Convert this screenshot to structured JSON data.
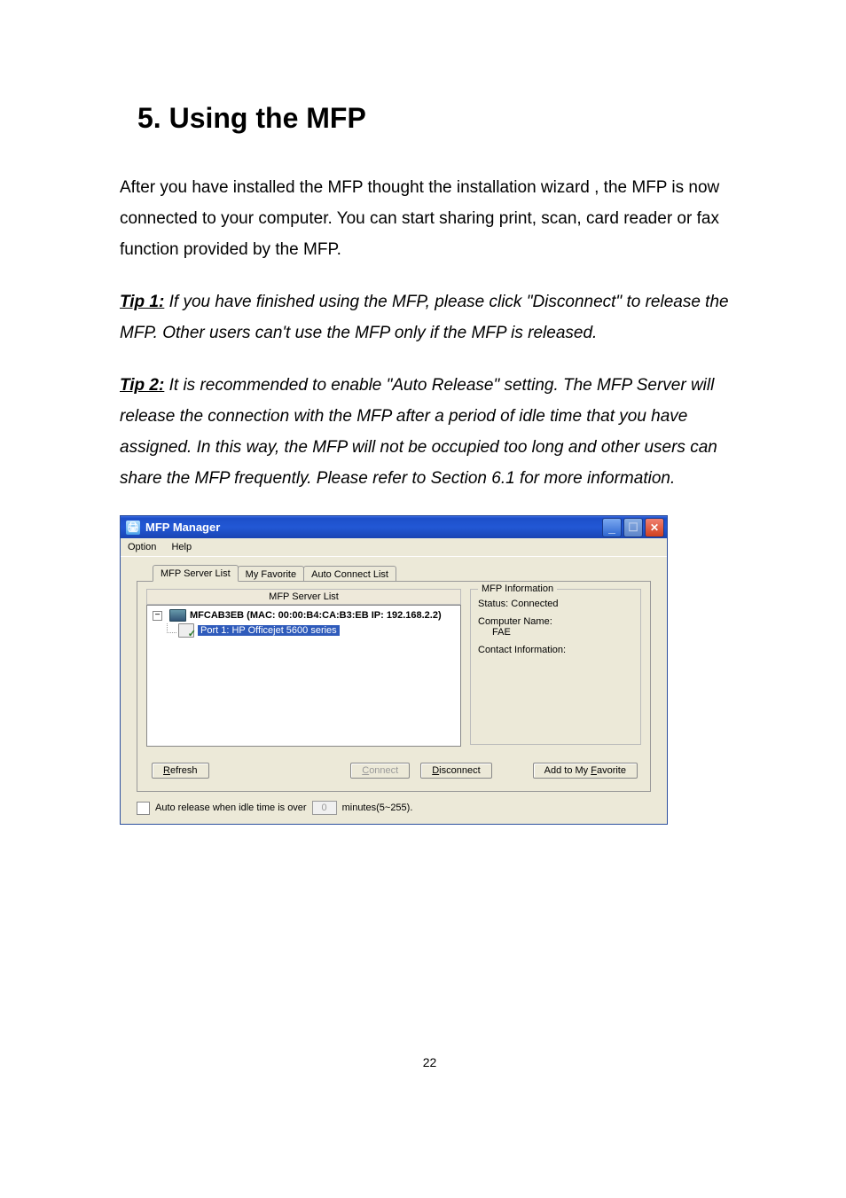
{
  "doc": {
    "heading": "5.  Using the MFP",
    "para1": "After you have installed the MFP thought the installation wizard , the MFP is now connected to your computer. You can start sharing print, scan, card reader or fax function provided by the MFP.",
    "tip1_label": "Tip 1:",
    "tip1_body": " If you have finished using the MFP, please click \"Disconnect\" to release the MFP. Other users can't use the MFP only if the MFP is released.",
    "tip2_label": "Tip 2:",
    "tip2_body": " It is recommended to enable \"Auto Release\" setting. The MFP Server will release the connection with the MFP after a period of idle time that you have assigned. In this way, the MFP will not be occupied too long and other users can share the MFP frequently. Please refer to Section 6.1 for more information.",
    "page_number": "22"
  },
  "window": {
    "title": "MFP Manager",
    "menu": {
      "option": "Option",
      "help": "Help"
    },
    "tabs": {
      "t1": "MFP Server List",
      "t2": "My Favorite",
      "t3": "Auto Connect List"
    },
    "server_list_header": "MFP Server List",
    "tree": {
      "server": "MFCAB3EB (MAC: 00:00:B4:CA:B3:EB   IP: 192.168.2.2)",
      "port": "Port 1: HP Officejet 5600 series"
    },
    "info": {
      "legend": "MFP Information",
      "status": "Status: Connected",
      "cn_label": "Computer Name:",
      "cn_value": "FAE",
      "ci_label": "Contact Information:"
    },
    "buttons": {
      "refresh": "Refresh",
      "connect": "Connect",
      "disconnect": "Disconnect",
      "fav": "Add to My Favorite"
    },
    "autorelease": {
      "label": "Auto release when idle time is over",
      "value": "0",
      "suffix": "minutes(5~255)."
    }
  }
}
